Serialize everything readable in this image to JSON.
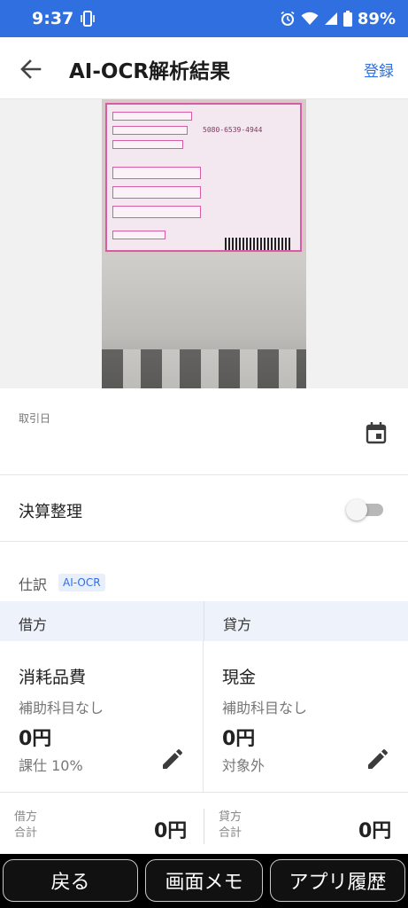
{
  "status_bar": {
    "time": "9:37",
    "battery": "89%",
    "color": "#2f6fe0"
  },
  "header": {
    "title": "AI-OCR解析結果",
    "register_label": "登録",
    "back_icon": "arrow-left-icon"
  },
  "receipt_image": {
    "form_number": "5080-6539-4944"
  },
  "date_field": {
    "label": "取引日",
    "value": "",
    "icon": "calendar-icon"
  },
  "settlement": {
    "label": "決算整理",
    "enabled": false
  },
  "journal": {
    "label": "仕訳",
    "badge": "AI-OCR",
    "debit_header": "借方",
    "credit_header": "貸方",
    "debit": {
      "account": "消耗品費",
      "sub_account": "補助科目なし",
      "amount": "0円",
      "tax": "課仕 10%"
    },
    "credit": {
      "account": "現金",
      "sub_account": "補助科目なし",
      "amount": "0円",
      "tax": "対象外"
    }
  },
  "totals": {
    "debit_label_1": "借方",
    "debit_label_2": "合計",
    "debit_amount": "0円",
    "credit_label_1": "貸方",
    "credit_label_2": "合計",
    "credit_amount": "0円"
  },
  "bottom_nav": {
    "back": "戻る",
    "memo": "画面メモ",
    "history": "アプリ履歴"
  }
}
